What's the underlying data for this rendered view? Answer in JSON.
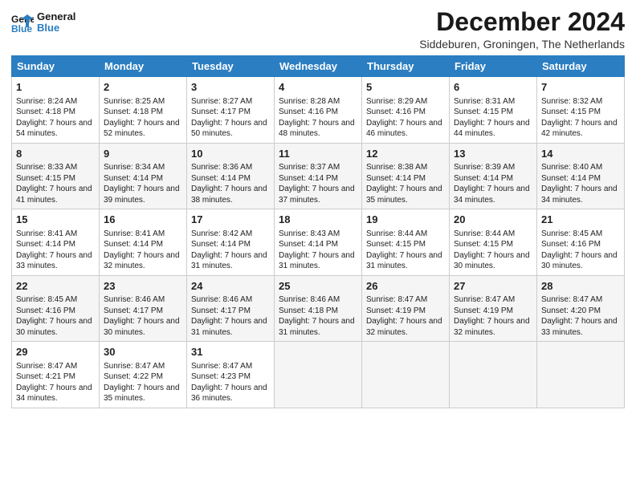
{
  "logo": {
    "line1": "General",
    "line2": "Blue"
  },
  "title": "December 2024",
  "location": "Siddeburen, Groningen, The Netherlands",
  "days_of_week": [
    "Sunday",
    "Monday",
    "Tuesday",
    "Wednesday",
    "Thursday",
    "Friday",
    "Saturday"
  ],
  "weeks": [
    [
      {
        "day": 1,
        "sunrise": "8:24 AM",
        "sunset": "4:18 PM",
        "daylight": "7 hours and 54 minutes."
      },
      {
        "day": 2,
        "sunrise": "8:25 AM",
        "sunset": "4:18 PM",
        "daylight": "7 hours and 52 minutes."
      },
      {
        "day": 3,
        "sunrise": "8:27 AM",
        "sunset": "4:17 PM",
        "daylight": "7 hours and 50 minutes."
      },
      {
        "day": 4,
        "sunrise": "8:28 AM",
        "sunset": "4:16 PM",
        "daylight": "7 hours and 48 minutes."
      },
      {
        "day": 5,
        "sunrise": "8:29 AM",
        "sunset": "4:16 PM",
        "daylight": "7 hours and 46 minutes."
      },
      {
        "day": 6,
        "sunrise": "8:31 AM",
        "sunset": "4:15 PM",
        "daylight": "7 hours and 44 minutes."
      },
      {
        "day": 7,
        "sunrise": "8:32 AM",
        "sunset": "4:15 PM",
        "daylight": "7 hours and 42 minutes."
      }
    ],
    [
      {
        "day": 8,
        "sunrise": "8:33 AM",
        "sunset": "4:15 PM",
        "daylight": "7 hours and 41 minutes."
      },
      {
        "day": 9,
        "sunrise": "8:34 AM",
        "sunset": "4:14 PM",
        "daylight": "7 hours and 39 minutes."
      },
      {
        "day": 10,
        "sunrise": "8:36 AM",
        "sunset": "4:14 PM",
        "daylight": "7 hours and 38 minutes."
      },
      {
        "day": 11,
        "sunrise": "8:37 AM",
        "sunset": "4:14 PM",
        "daylight": "7 hours and 37 minutes."
      },
      {
        "day": 12,
        "sunrise": "8:38 AM",
        "sunset": "4:14 PM",
        "daylight": "7 hours and 35 minutes."
      },
      {
        "day": 13,
        "sunrise": "8:39 AM",
        "sunset": "4:14 PM",
        "daylight": "7 hours and 34 minutes."
      },
      {
        "day": 14,
        "sunrise": "8:40 AM",
        "sunset": "4:14 PM",
        "daylight": "7 hours and 34 minutes."
      }
    ],
    [
      {
        "day": 15,
        "sunrise": "8:41 AM",
        "sunset": "4:14 PM",
        "daylight": "7 hours and 33 minutes."
      },
      {
        "day": 16,
        "sunrise": "8:41 AM",
        "sunset": "4:14 PM",
        "daylight": "7 hours and 32 minutes."
      },
      {
        "day": 17,
        "sunrise": "8:42 AM",
        "sunset": "4:14 PM",
        "daylight": "7 hours and 31 minutes."
      },
      {
        "day": 18,
        "sunrise": "8:43 AM",
        "sunset": "4:14 PM",
        "daylight": "7 hours and 31 minutes."
      },
      {
        "day": 19,
        "sunrise": "8:44 AM",
        "sunset": "4:15 PM",
        "daylight": "7 hours and 31 minutes."
      },
      {
        "day": 20,
        "sunrise": "8:44 AM",
        "sunset": "4:15 PM",
        "daylight": "7 hours and 30 minutes."
      },
      {
        "day": 21,
        "sunrise": "8:45 AM",
        "sunset": "4:16 PM",
        "daylight": "7 hours and 30 minutes."
      }
    ],
    [
      {
        "day": 22,
        "sunrise": "8:45 AM",
        "sunset": "4:16 PM",
        "daylight": "7 hours and 30 minutes."
      },
      {
        "day": 23,
        "sunrise": "8:46 AM",
        "sunset": "4:17 PM",
        "daylight": "7 hours and 30 minutes."
      },
      {
        "day": 24,
        "sunrise": "8:46 AM",
        "sunset": "4:17 PM",
        "daylight": "7 hours and 31 minutes."
      },
      {
        "day": 25,
        "sunrise": "8:46 AM",
        "sunset": "4:18 PM",
        "daylight": "7 hours and 31 minutes."
      },
      {
        "day": 26,
        "sunrise": "8:47 AM",
        "sunset": "4:19 PM",
        "daylight": "7 hours and 32 minutes."
      },
      {
        "day": 27,
        "sunrise": "8:47 AM",
        "sunset": "4:19 PM",
        "daylight": "7 hours and 32 minutes."
      },
      {
        "day": 28,
        "sunrise": "8:47 AM",
        "sunset": "4:20 PM",
        "daylight": "7 hours and 33 minutes."
      }
    ],
    [
      {
        "day": 29,
        "sunrise": "8:47 AM",
        "sunset": "4:21 PM",
        "daylight": "7 hours and 34 minutes."
      },
      {
        "day": 30,
        "sunrise": "8:47 AM",
        "sunset": "4:22 PM",
        "daylight": "7 hours and 35 minutes."
      },
      {
        "day": 31,
        "sunrise": "8:47 AM",
        "sunset": "4:23 PM",
        "daylight": "7 hours and 36 minutes."
      },
      null,
      null,
      null,
      null
    ]
  ]
}
